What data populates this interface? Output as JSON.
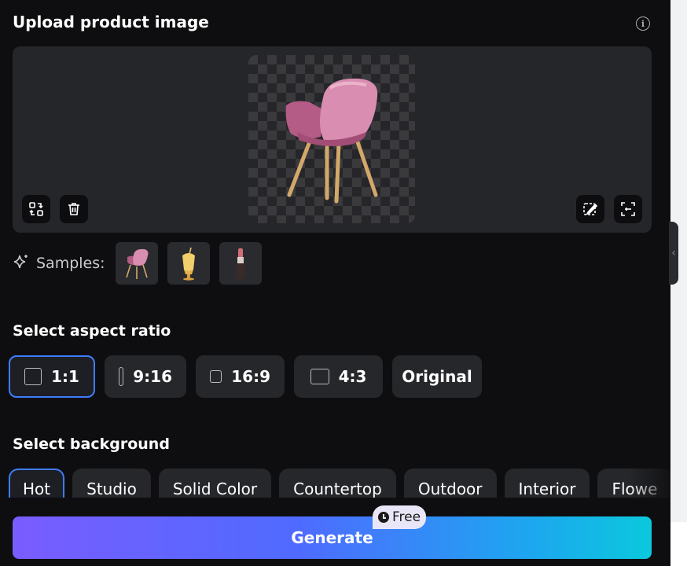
{
  "upload": {
    "title": "Upload product image",
    "info_icon": "info-icon",
    "tools_left": [
      "replace-icon",
      "trash-icon"
    ],
    "tools_right": [
      "edit-image-icon",
      "scan-icon"
    ]
  },
  "samples": {
    "label": "Samples:",
    "icon": "sparkle-icon",
    "items": [
      "chair",
      "milkshake",
      "lipstick"
    ]
  },
  "aspect": {
    "title": "Select aspect ratio",
    "options": [
      "1:1",
      "9:16",
      "16:9",
      "4:3",
      "Original"
    ],
    "selected": "1:1"
  },
  "background": {
    "title": "Select background",
    "options": [
      "Hot",
      "Studio",
      "Solid Color",
      "Countertop",
      "Outdoor",
      "Interior",
      "Flowe"
    ],
    "selected": "Hot"
  },
  "generate": {
    "label": "Generate",
    "badge": "Free"
  },
  "colors": {
    "accent": "#3f7cff",
    "panel": "#0e0e10",
    "gradient_start": "#7a5cff",
    "gradient_end": "#0bc8dd"
  }
}
